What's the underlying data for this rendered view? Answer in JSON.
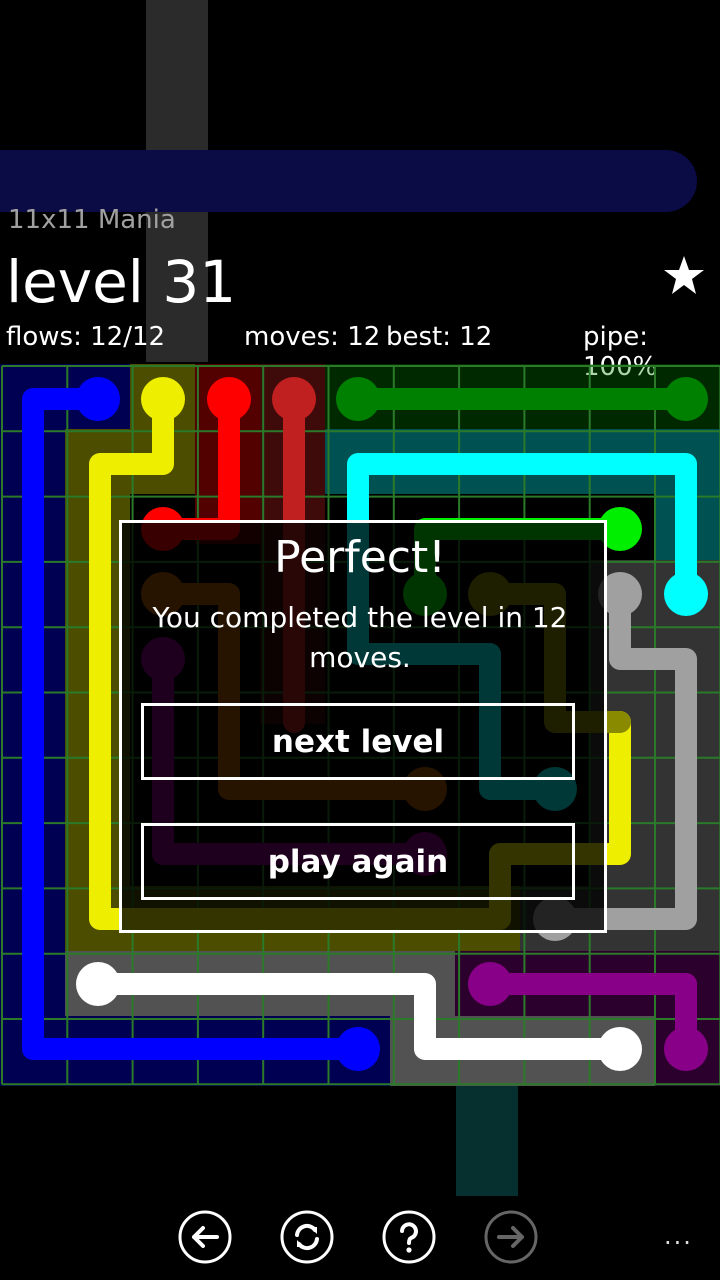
{
  "header": {
    "pack": "11x11 Mania",
    "level": "level 31",
    "flows": "flows: 12/12",
    "moves": "moves: 12",
    "best": "best: 12",
    "pipe": "pipe: 100%"
  },
  "dialog": {
    "title": "Perfect!",
    "message": "You completed the level in 12 moves.",
    "next_label": "next level",
    "again_label": "play again"
  },
  "appbar": {
    "icons": [
      "back-arrow-icon",
      "refresh-icon",
      "help-icon",
      "forward-arrow-icon"
    ],
    "more": "..."
  },
  "colors": {
    "blue": "#0000ff",
    "yellow": "#eeee00",
    "red": "#ff0000",
    "darkred": "#c02020",
    "green": "#008000",
    "lime": "#00ee00",
    "cyan": "#00ffff",
    "orange": "#b05a00",
    "purple": "#880088",
    "teal": "#008080",
    "gray": "#a0a0a0",
    "white": "#ffffff"
  }
}
